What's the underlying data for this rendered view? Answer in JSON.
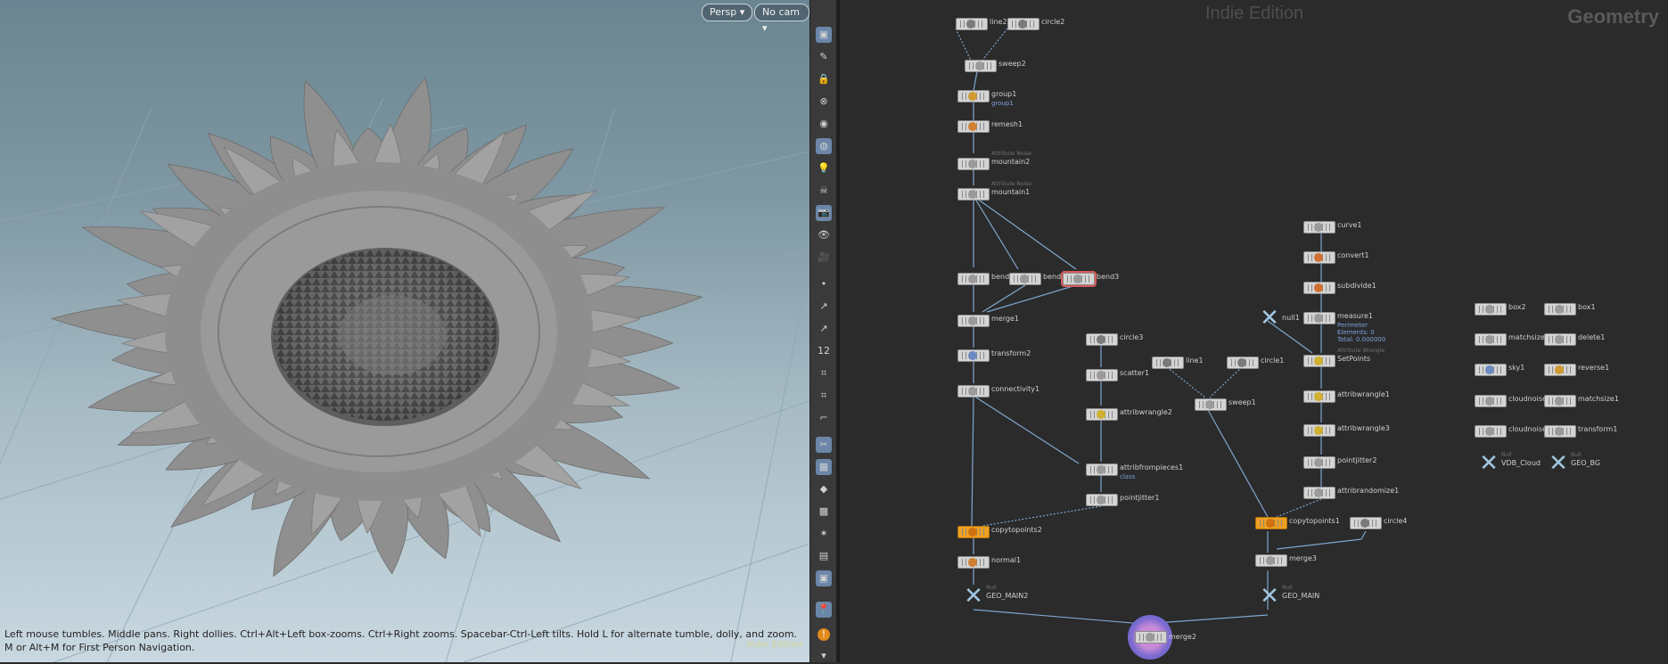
{
  "viewport": {
    "camera_menu": "Persp",
    "cam_menu": "No cam",
    "help_text": "Left mouse tumbles. Middle pans. Right dollies. Ctrl+Alt+Left box-zooms. Ctrl+Right zooms. Spacebar-Ctrl-Left tilts. Hold L for alternate tumble, dolly, and zoom.    M or Alt+M for First Person Navigation.",
    "watermark": "Indie Edition",
    "model_icon": "sunflower-geometry"
  },
  "toolbar": {
    "items": [
      {
        "name": "select-icon",
        "glyph": "▣",
        "active": true
      },
      {
        "name": "brush-icon",
        "glyph": "✎",
        "active": false
      },
      {
        "name": "lock-icon",
        "glyph": "🔒",
        "active": false
      },
      {
        "name": "ghost-icon",
        "glyph": "⊗",
        "active": false
      },
      {
        "name": "shading-icon",
        "glyph": "◉",
        "active": false
      },
      {
        "name": "highlight-icon",
        "glyph": "◍",
        "active": true
      },
      {
        "name": "light-icon",
        "glyph": "💡",
        "active": false
      },
      {
        "name": "skull-icon",
        "glyph": "☠",
        "active": false
      },
      {
        "name": "camera-icon",
        "glyph": "📷",
        "active": true
      },
      {
        "name": "eye-icon",
        "glyph": "👁",
        "active": false
      },
      {
        "name": "record-icon",
        "glyph": "🎥",
        "active": false
      },
      {
        "name": "point-icon",
        "glyph": "•",
        "active": false
      },
      {
        "name": "normal-icon",
        "glyph": "↗",
        "active": false
      },
      {
        "name": "vector-icon",
        "glyph": "↗",
        "active": false
      },
      {
        "name": "number-icon",
        "glyph": "12",
        "active": false
      },
      {
        "name": "prim-number-icon",
        "glyph": "⌗",
        "active": false
      },
      {
        "name": "vertex-number-icon",
        "glyph": "⌗",
        "active": false
      },
      {
        "name": "ruler-icon",
        "glyph": "⌐",
        "active": false
      },
      {
        "name": "snap-icon",
        "glyph": "✂",
        "active": true
      },
      {
        "name": "grid-snap-icon",
        "glyph": "▦",
        "active": true
      },
      {
        "name": "layer-icon",
        "glyph": "◆",
        "active": false
      },
      {
        "name": "map-icon",
        "glyph": "▩",
        "active": false
      },
      {
        "name": "axis-icon",
        "glyph": "✶",
        "active": false
      },
      {
        "name": "display-icon",
        "glyph": "▤",
        "active": false
      },
      {
        "name": "background-icon",
        "glyph": "▣",
        "active": true
      },
      {
        "name": "pin-icon",
        "glyph": "📍",
        "active": true
      },
      {
        "name": "warning-icon",
        "glyph": "!",
        "active": false
      },
      {
        "name": "more-icon",
        "glyph": "▾",
        "active": false
      }
    ]
  },
  "network": {
    "context": "Geometry",
    "edition": "Indie Edition",
    "nodes": [
      {
        "id": "line2",
        "label": "line2"
      },
      {
        "id": "circle2",
        "label": "circle2"
      },
      {
        "id": "sweep2",
        "label": "sweep2"
      },
      {
        "id": "group1",
        "label": "group1",
        "note": "group1"
      },
      {
        "id": "remesh1",
        "label": "remesh1"
      },
      {
        "id": "mountain2",
        "label": "mountain2",
        "sub": "Attribute Noise"
      },
      {
        "id": "mountain1",
        "label": "mountain1",
        "sub": "Attribute Noise"
      },
      {
        "id": "bend1",
        "label": "bend1"
      },
      {
        "id": "bend2",
        "label": "bend2"
      },
      {
        "id": "bend3",
        "label": "bend3"
      },
      {
        "id": "merge1",
        "label": "merge1"
      },
      {
        "id": "transform2",
        "label": "transform2"
      },
      {
        "id": "connectivity1",
        "label": "connectivity1"
      },
      {
        "id": "circle3",
        "label": "circle3"
      },
      {
        "id": "scatter1",
        "label": "scatter1"
      },
      {
        "id": "attribwrangle2",
        "label": "attribwrangle2"
      },
      {
        "id": "attribfrompieces1",
        "label": "attribfrompieces1",
        "note": "class"
      },
      {
        "id": "pointjitter1",
        "label": "pointjitter1"
      },
      {
        "id": "copytopoints2",
        "label": "copytopoints2"
      },
      {
        "id": "normal1",
        "label": "normal1"
      },
      {
        "id": "GEO_MAIN2",
        "label": "GEO_MAIN2",
        "sub": "Null"
      },
      {
        "id": "line1",
        "label": "line1"
      },
      {
        "id": "circle1",
        "label": "circle1"
      },
      {
        "id": "sweep1",
        "label": "sweep1"
      },
      {
        "id": "curve1",
        "label": "curve1"
      },
      {
        "id": "convert1",
        "label": "convert1"
      },
      {
        "id": "subdivide1",
        "label": "subdivide1"
      },
      {
        "id": "null1",
        "label": "null1"
      },
      {
        "id": "measure1",
        "label": "measure1",
        "note": "Perimeter\nElements: 0\nTotal: 0.000000"
      },
      {
        "id": "SetPoints",
        "label": "SetPoints",
        "sub": "Attribute Wrangle"
      },
      {
        "id": "attribwrangle1",
        "label": "attribwrangle1"
      },
      {
        "id": "attribwrangle3",
        "label": "attribwrangle3"
      },
      {
        "id": "pointjitter2",
        "label": "pointjitter2"
      },
      {
        "id": "attribrandomize1",
        "label": "attribrandomize1"
      },
      {
        "id": "copytopoints1",
        "label": "copytopoints1"
      },
      {
        "id": "circle4",
        "label": "circle4"
      },
      {
        "id": "merge3",
        "label": "merge3"
      },
      {
        "id": "GEO_MAIN",
        "label": "GEO_MAIN",
        "sub": "Null"
      },
      {
        "id": "merge2",
        "label": "merge2"
      },
      {
        "id": "box2",
        "label": "box2"
      },
      {
        "id": "matchsize2",
        "label": "matchsize2"
      },
      {
        "id": "sky1",
        "label": "sky1"
      },
      {
        "id": "cloudnoise1",
        "label": "cloudnoise1"
      },
      {
        "id": "cloudnoise2",
        "label": "cloudnoise2"
      },
      {
        "id": "VDB_Cloud",
        "label": "VDB_Cloud",
        "sub": "Null"
      },
      {
        "id": "box1",
        "label": "box1"
      },
      {
        "id": "delete1",
        "label": "delete1"
      },
      {
        "id": "reverse1",
        "label": "reverse1"
      },
      {
        "id": "matchsize1",
        "label": "matchsize1"
      },
      {
        "id": "transform1",
        "label": "transform1"
      },
      {
        "id": "GEO_BG",
        "label": "GEO_BG",
        "sub": "Null"
      }
    ]
  }
}
